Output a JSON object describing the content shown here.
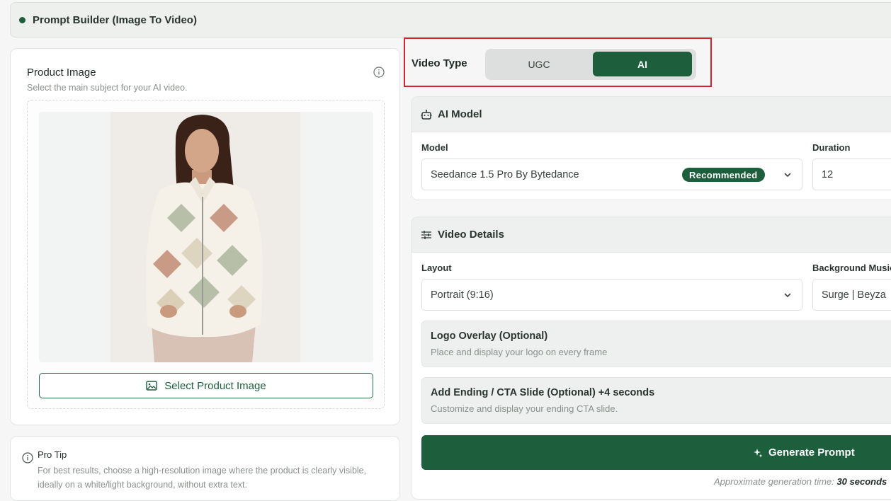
{
  "header": {
    "title": "Prompt Builder (Image To Video)"
  },
  "product_image": {
    "title": "Product Image",
    "subtitle": "Select the main subject for your AI video.",
    "select_button": "Select Product Image"
  },
  "pro_tip": {
    "title": "Pro Tip",
    "text": "For best results, choose a high-resolution image where the product is clearly visible, ideally on a white/light background, without extra text."
  },
  "video_type": {
    "label": "Video Type",
    "options": [
      "UGC",
      "AI"
    ],
    "selected": "AI"
  },
  "ai_model": {
    "heading": "AI Model",
    "model_label": "Model",
    "model_value": "Seedance 1.5 Pro By Bytedance",
    "model_badge": "Recommended",
    "duration_label": "Duration",
    "duration_value": "12"
  },
  "video_details": {
    "heading": "Video Details",
    "layout_label": "Layout",
    "layout_value": "Portrait (9:16)",
    "music_label": "Background Music",
    "music_value": "Surge | Beyza",
    "logo_title": "Logo Overlay (Optional)",
    "logo_sub": "Place and display your logo on every frame",
    "cta_title": "Add Ending / CTA Slide (Optional) +4 seconds",
    "cta_sub": "Customize and display your ending CTA slide.",
    "generate_button": "Generate Prompt",
    "approx_label": "Approximate generation time:",
    "approx_value": "30 seconds"
  },
  "colors": {
    "primary": "#1d5e3c",
    "highlight": "#d3262c",
    "muted_text": "#8a908c"
  }
}
